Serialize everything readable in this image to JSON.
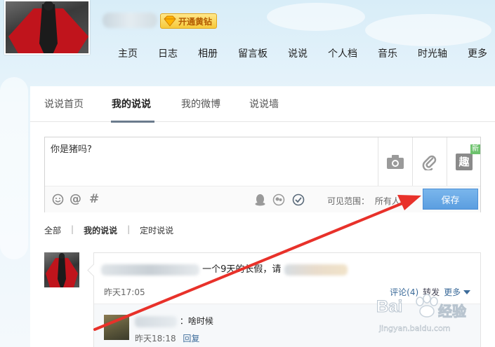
{
  "header": {
    "vip_button_label": "开通黄钻",
    "nav_items": [
      "主页",
      "日志",
      "相册",
      "留言板",
      "说说",
      "个人档",
      "音乐",
      "时光轴",
      "更多"
    ]
  },
  "tabs": [
    "说说首页",
    "我的说说",
    "我的微博",
    "说说墙"
  ],
  "active_tab": "我的说说",
  "composer": {
    "text": "你是猪吗?",
    "new_badge": "新",
    "fun_icon_glyph": "趣",
    "visible_range_label": "可见范围：",
    "visible_range_value": "所有人",
    "save_label": "保存"
  },
  "filters": [
    "全部",
    "我的说说",
    "定时说说"
  ],
  "filter_separator": "|",
  "post": {
    "text_visible": "一个9天的长假，请",
    "time": "昨天17:05",
    "comments_label": "评论(4)",
    "forward_label": "转发",
    "more_label": "更多"
  },
  "comment": {
    "text": "：啥时候",
    "time": "昨天18:18",
    "reply_label": "回复"
  },
  "watermark": {
    "brand": "Bai",
    "brand_suffix": "经验",
    "url": "jingyan.baidu.com"
  },
  "colors": {
    "accent_blue": "#5b9ee0",
    "arrow_red": "#e8312a",
    "vip_gold": "#f6c93a"
  }
}
